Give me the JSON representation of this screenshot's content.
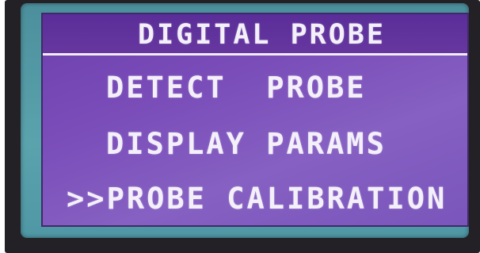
{
  "header": {
    "title": "DIGITAL PROBE"
  },
  "menu": {
    "items": [
      {
        "label": "DETECT  PROBE",
        "selected": false
      },
      {
        "label": "DISPLAY PARAMS",
        "selected": false
      },
      {
        "label": "PROBE CALIBRATION",
        "selected": true
      }
    ],
    "cursor": ">>"
  },
  "colors": {
    "screen": "#7a4db9",
    "title_bar": "#5a2d98",
    "text": "#f4f0fa",
    "bezel": "#5aa3ad"
  }
}
